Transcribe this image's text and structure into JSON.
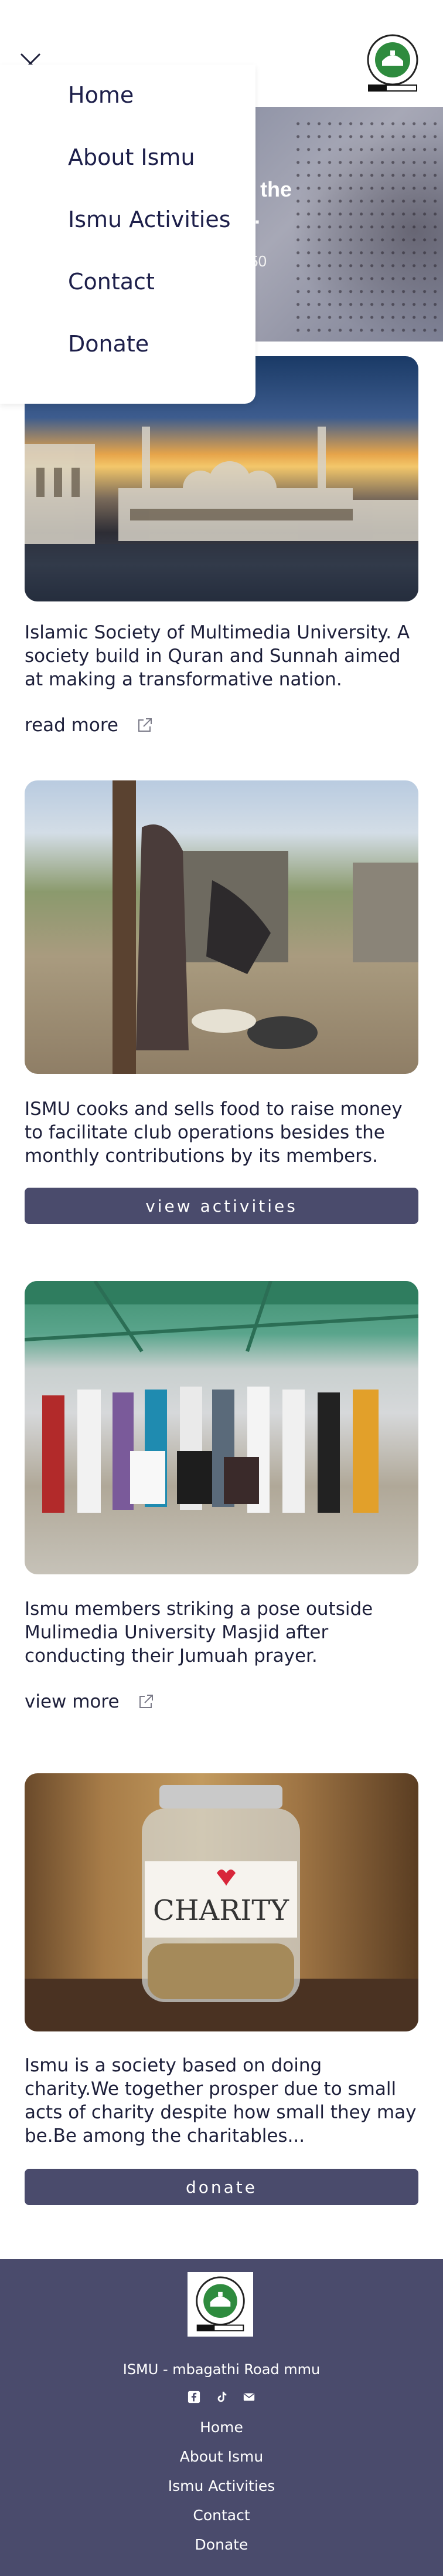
{
  "header": {
    "close_icon": "close-icon",
    "logo_icon": "ismu-logo-icon"
  },
  "menu": {
    "items": [
      {
        "label": "Home"
      },
      {
        "label": "About Ismu"
      },
      {
        "label": "Ismu Activities"
      },
      {
        "label": "Contact"
      },
      {
        "label": "Donate"
      }
    ]
  },
  "hero": {
    "text_line1": "or,and He is the",
    "text_line2": "ers.",
    "reference": "3:150"
  },
  "cards": [
    {
      "image": "mosque-photo",
      "text": "Islamic Society of Multimedia University. A society build in Quran and Sunnah aimed at making a transformative nation.",
      "link_label": "read more"
    },
    {
      "image": "cooking-photo",
      "text": "ISMU cooks and sells food to raise money to facilitate club operations besides the monthly contributions by its members.",
      "button_label": "view activities"
    },
    {
      "image": "group-photo",
      "text": "Ismu members striking a pose outside Mulimedia University Masjid after conducting their Jumuah prayer.",
      "link_label": "view more"
    },
    {
      "image": "charity-jar-photo",
      "jar_label": "CHARITY",
      "text": "Ismu is a society based on doing charity.We together prosper due to small acts of charity despite how small they may be.Be among the charitables...",
      "button_label": "donate"
    }
  ],
  "footer": {
    "address": "ISMU - mbagathi Road mmu",
    "socials": [
      "facebook-icon",
      "tiktok-icon",
      "email-icon"
    ],
    "nav": [
      {
        "label": "Home"
      },
      {
        "label": "About Ismu"
      },
      {
        "label": "Ismu Activities"
      },
      {
        "label": "Contact"
      },
      {
        "label": "Donate"
      }
    ]
  },
  "colors": {
    "accent": "#4a4b6c",
    "text": "#1d1f3a",
    "logo_green": "#2e8b3e"
  }
}
